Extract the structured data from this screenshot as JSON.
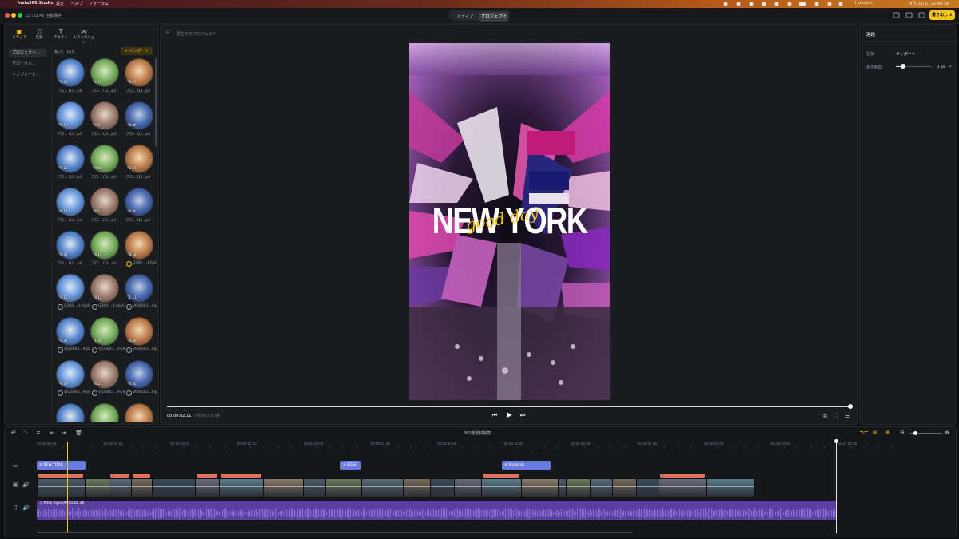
{
  "menubar": {
    "app": "Insta360 Studio",
    "items": [
      "設定",
      "ヘルプ",
      "フォーラム"
    ],
    "user": "d_wackys",
    "clock": "4月2日(火) 22:46:38"
  },
  "titlebar": {
    "autosave": "22:32:43 自動保存",
    "tabs": [
      "メディア",
      "プロジェクト"
    ],
    "export_label": "書き出し"
  },
  "sidebar": {
    "tabs": [
      "メディア",
      "音楽",
      "テキスト",
      "トランジション"
    ],
    "categories": [
      "プロジェクト...",
      "グローバル...",
      "テンプレート..."
    ]
  },
  "media": {
    "count_label": "輸入：183",
    "import_label": "+ インポート",
    "items": [
      {
        "label": "プロ... Q3...p4",
        "dur": "00:08"
      },
      {
        "label": "プロ... Q3...p4",
        "dur": "02:10"
      },
      {
        "label": "プロ... Q3...p4",
        "dur": "00:07"
      },
      {
        "label": "プロ... Q3...p4",
        "dur": "00:10"
      },
      {
        "label": "プロ... Q3...p4",
        "dur": "00:07"
      },
      {
        "label": "プロ... Q3...p4",
        "dur": "00:08"
      },
      {
        "label": "プロ... Q3...p4",
        "dur": "00:13"
      },
      {
        "label": "プロ... Q3...p4",
        "dur": "00:10"
      },
      {
        "label": "プロ... Q3...p4",
        "dur": "02:21"
      },
      {
        "label": "プロ... Q3...p4",
        "dur": "00:11"
      },
      {
        "label": "プロ... Q3...p4",
        "dur": "00:14"
      },
      {
        "label": "プロ... Q3...p4",
        "dur": "00:30"
      },
      {
        "label": "プロ... Q3...p4",
        "dur": "00:07"
      },
      {
        "label": "プロ... Q3...p4",
        "dur": "00:14"
      },
      {
        "label": "Q360_...t.mp4",
        "dur": "00:18"
      },
      {
        "label": "Q360_...t.mp4",
        "dur": "00:12"
      },
      {
        "label": "Q360_...t.mp4",
        "dur": "00:12"
      },
      {
        "label": "VID0003...mp4",
        "dur": "01:13"
      },
      {
        "label": "VID0003...mp4",
        "dur": "00:47"
      },
      {
        "label": "VID0003...mp4",
        "dur": "01:00"
      },
      {
        "label": "VID0003...mp4",
        "dur": "00:49"
      },
      {
        "label": "VID0003...mp4",
        "dur": "00:49"
      },
      {
        "label": "VID0003...mp4",
        "dur": "00:21"
      },
      {
        "label": "VID0003...mp4",
        "dur": "00:32"
      },
      {
        "label": "",
        "dur": ""
      },
      {
        "label": "",
        "dur": ""
      },
      {
        "label": "",
        "dur": ""
      }
    ]
  },
  "preview": {
    "header": "再生中のプロジェクト",
    "title_main": "NEW YORK",
    "title_script": "good day",
    "time_current": "00:00:02.11",
    "time_total": "00:00:59.56"
  },
  "inspector": {
    "title": "連結",
    "name_label": "名前",
    "name_value": "テレポート",
    "duration_label": "再生時間",
    "duration_value": "0.5s",
    "duration_fraction": 0.2
  },
  "timeline": {
    "mode_label": "360度素材編集",
    "ruler": [
      "00:00:00.00",
      "00:00:05.00",
      "00:00:10.00",
      "00:00:15.00",
      "00:00:20.00",
      "00:00:25.00",
      "00:00:30.00",
      "00:00:35.00",
      "00:00:40.00",
      "00:00:45.00",
      "00:00:50.00",
      "00:00:55.00",
      "00:01:00.00"
    ],
    "text_clips": [
      "NEW YORK",
      "EDGE",
      "Brooklyn"
    ],
    "audio_label": "Wise.mp3",
    "audio_time": "00:00:08.26"
  },
  "colors": {
    "accent": "#f5c518",
    "audio": "#5a3f9e",
    "text_clip": "#6a7be0",
    "transition": "#e07060"
  }
}
